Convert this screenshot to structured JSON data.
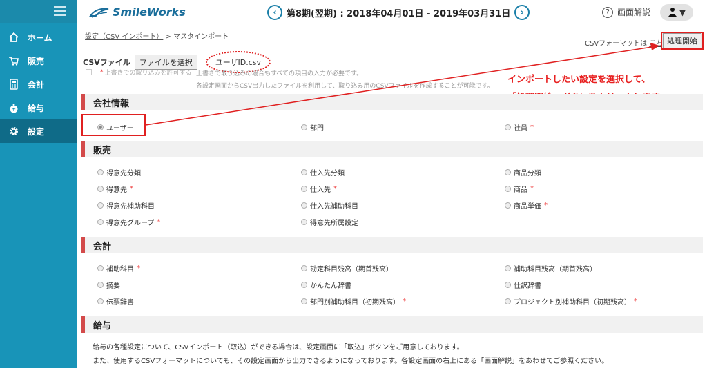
{
  "app": {
    "logo": "SmileWorks",
    "help": "画面解説",
    "period": "第8期(翌期) : 2018年04月01日 - 2019年03月31日"
  },
  "sidebar": {
    "items": [
      {
        "label": "ホーム",
        "icon": "home-icon"
      },
      {
        "label": "販売",
        "icon": "cart-icon"
      },
      {
        "label": "会計",
        "icon": "calculator-icon"
      },
      {
        "label": "給与",
        "icon": "moneybag-icon"
      },
      {
        "label": "設定",
        "icon": "gear-icon"
      }
    ]
  },
  "breadcrumb": {
    "parent": "設定（CSV インポート）",
    "sep": ">",
    "current": "マスタインポート"
  },
  "format_note": {
    "prefix": "CSVフォーマットは",
    "link": "こちら"
  },
  "process_button": "処理開始",
  "file": {
    "label": "CSVファイル",
    "button": "ファイルを選択",
    "name": "ユーザID.csv"
  },
  "overwrite": {
    "marker": "*",
    "label": "上書きでの取り込みを許可する",
    "note1": "上書きで取り込みの場合もすべての項目の入力が必要です。",
    "note2": "各設定画面からCSV出力したファイルを利用して、取り込み用のCSVファイルを作成することが可能です。"
  },
  "callout": {
    "line1": "インポートしたい設定を選択して、",
    "line2": "「処理開始」ボタンをクリックします。"
  },
  "sections": {
    "company": {
      "title": "会社情報",
      "options": [
        {
          "label": "ユーザー",
          "required": ""
        },
        {
          "label": "部門",
          "required": ""
        },
        {
          "label": "社員",
          "required": "*"
        }
      ]
    },
    "sales": {
      "title": "販売",
      "options": [
        {
          "label": "得意先分類",
          "required": ""
        },
        {
          "label": "仕入先分類",
          "required": ""
        },
        {
          "label": "商品分類",
          "required": ""
        },
        {
          "label": "得意先",
          "required": "*"
        },
        {
          "label": "仕入先",
          "required": "*"
        },
        {
          "label": "商品",
          "required": "*"
        },
        {
          "label": "得意先補助科目",
          "required": ""
        },
        {
          "label": "仕入先補助科目",
          "required": ""
        },
        {
          "label": "商品単価",
          "required": "*"
        },
        {
          "label": "得意先グループ",
          "required": "*"
        },
        {
          "label": "得意先所属設定",
          "required": ""
        }
      ]
    },
    "accounting": {
      "title": "会計",
      "options": [
        {
          "label": "補助科目",
          "required": "*"
        },
        {
          "label": "勘定科目残高（期首残高）",
          "required": ""
        },
        {
          "label": "補助科目残高（期首残高）",
          "required": ""
        },
        {
          "label": "摘要",
          "required": ""
        },
        {
          "label": "かんたん辞書",
          "required": ""
        },
        {
          "label": "仕訳辞書",
          "required": ""
        },
        {
          "label": "伝票辞書",
          "required": ""
        },
        {
          "label": "部門別補助科目（初期残高）",
          "required": "*"
        },
        {
          "label": "プロジェクト別補助科目（初期残高）",
          "required": "*"
        }
      ]
    },
    "payroll": {
      "title": "給与",
      "text1": "給与の各種設定について、CSVインポート（取込）ができる場合は、設定画面に「取込」ボタンをご用意しております。",
      "text2": "また、使用するCSVフォーマットについても、その設定画面から出力できるようになっております。各設定画面の右上にある「画面解説」をあわせてご参照ください。"
    }
  },
  "colors": {
    "sidebar": "#1894b8",
    "accent": "#d34a4a",
    "callout": "#e82020"
  }
}
